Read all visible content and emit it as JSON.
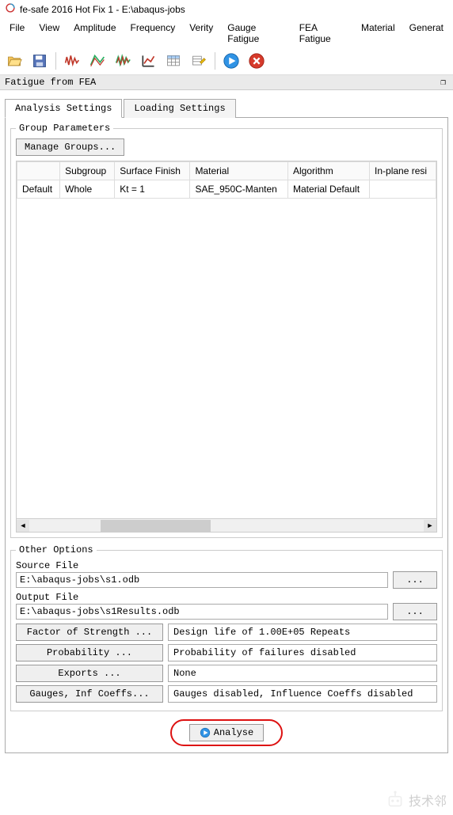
{
  "window": {
    "title": "fe-safe 2016 Hot Fix 1 - E:\\abaqus-jobs"
  },
  "menu": [
    "File",
    "View",
    "Amplitude",
    "Frequency",
    "Verity",
    "Gauge Fatigue",
    "FEA Fatigue",
    "Material",
    "Generat"
  ],
  "panel_label": "Fatigue from FEA",
  "tabs": {
    "analysis": "Analysis Settings",
    "loading": "Loading Settings"
  },
  "group_parameters": {
    "legend": "Group Parameters",
    "manage_btn": "Manage Groups...",
    "headers": [
      "",
      "Subgroup",
      "Surface Finish",
      "Material",
      "Algorithm",
      "In-plane resi"
    ],
    "row": [
      "Default",
      "Whole",
      "Kt = 1",
      "SAE_950C-Manten",
      "Material Default",
      ""
    ]
  },
  "other_options": {
    "legend": "Other Options",
    "source_label": "Source File",
    "source_value": "E:\\abaqus-jobs\\s1.odb",
    "output_label": "Output File",
    "output_value": "E:\\abaqus-jobs\\s1Results.odb",
    "browse": "...",
    "rows": [
      {
        "btn": "Factor of Strength ...",
        "val": "Design life of 1.00E+05 Repeats"
      },
      {
        "btn": "Probability ...",
        "val": "Probability of failures disabled"
      },
      {
        "btn": "Exports ...",
        "val": "None"
      },
      {
        "btn": "Gauges, Inf Coeffs...",
        "val": "Gauges disabled, Influence Coeffs disabled"
      }
    ]
  },
  "analyse_label": "Analyse",
  "watermark_text": "技术邻"
}
